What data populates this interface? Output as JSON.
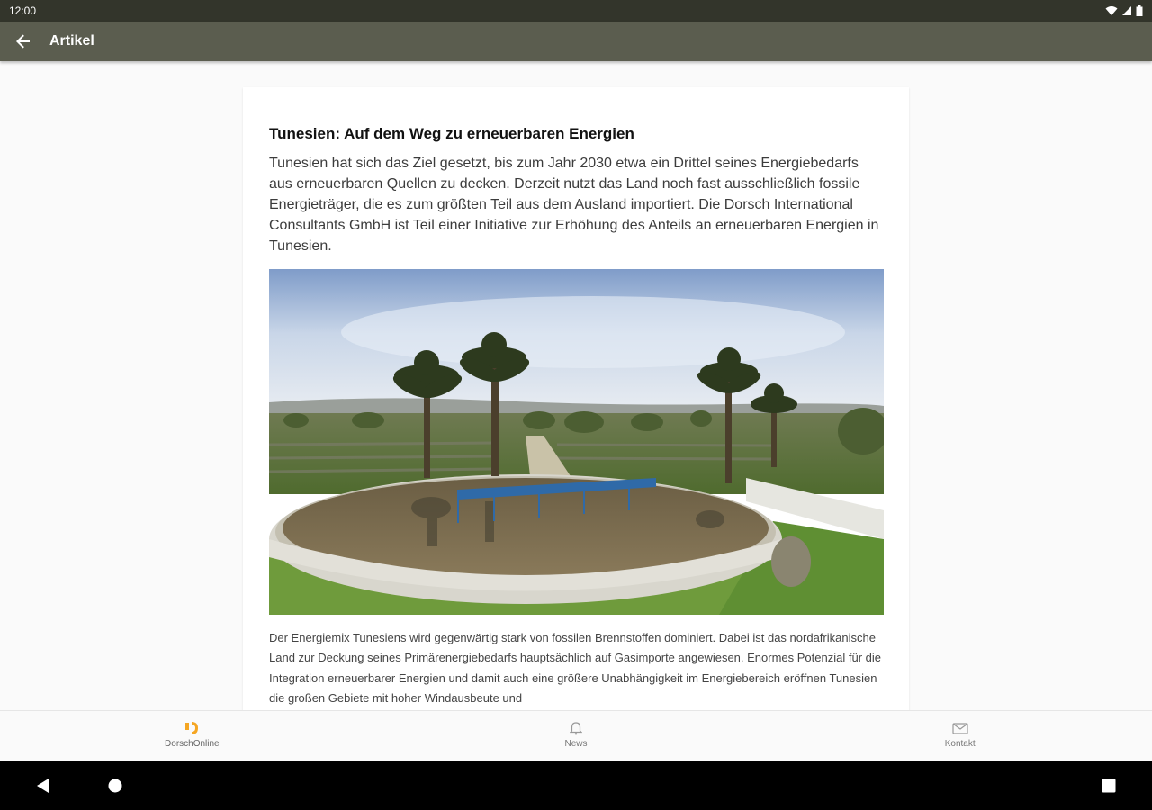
{
  "status_bar": {
    "time": "12:00",
    "icons": [
      "wifi-icon",
      "signal-icon",
      "battery-icon"
    ]
  },
  "app_bar": {
    "title": "Artikel",
    "back_icon": "arrow-back-icon"
  },
  "article": {
    "title": "Tunesien: Auf dem Weg zu erneuerbaren Energien",
    "lead": "Tunesien hat sich das Ziel gesetzt, bis zum Jahr 2030 etwa ein Drittel seines Energiebedarfs aus erneuerbaren Quellen zu decken. Derzeit nutzt das Land noch fast ausschließlich fossile Energieträger, die es zum größten Teil aus dem Ausland importiert. Die Dorsch International Consultants GmbH ist Teil einer Initiative zur Erhöhung des Anteils an erneuerbaren Energien in Tunesien.",
    "image": "wastewater-treatment-plant-photo",
    "body": "Der Energiemix Tunesiens wird gegenwärtig stark von fossilen Brennstoffen dominiert. Dabei ist das nordafrikanische Land zur Deckung seines Primärenergiebedarfs hauptsächlich auf Gasimporte angewiesen. Enormes Potenzial für die Integration erneuerbarer Energien und damit auch eine größere Unabhängigkeit im Energiebereich eröffnen Tunesien die großen Gebiete mit hoher Windausbeute und"
  },
  "bottom_nav": {
    "items": [
      {
        "label": "DorschOnline",
        "icon": "dorsch-logo-icon",
        "active": true
      },
      {
        "label": "News",
        "icon": "bell-icon",
        "active": false
      },
      {
        "label": "Kontakt",
        "icon": "mail-icon",
        "active": false
      }
    ]
  },
  "colors": {
    "status_bar": "#33352b",
    "app_bar": "#5b5d4f",
    "accent": "#f5a623",
    "background": "#fafafa"
  },
  "system_nav": {
    "buttons": [
      "back-triangle-icon",
      "home-circle-icon",
      "recents-square-icon"
    ]
  }
}
